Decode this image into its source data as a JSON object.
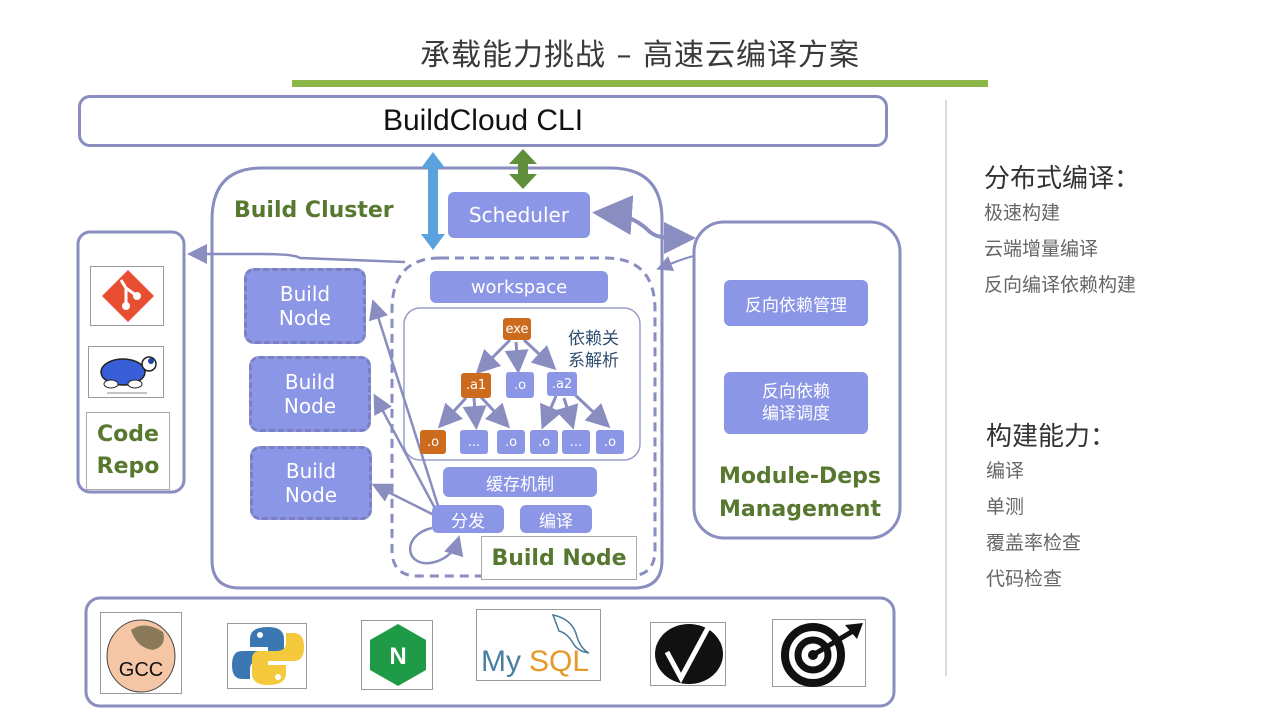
{
  "title": "承载能力挑战 – 高速云编译方案",
  "cli": {
    "label": "BuildCloud CLI"
  },
  "build_cluster": {
    "label": "Build Cluster",
    "scheduler": "Scheduler",
    "build_nodes": [
      "Build\nNode",
      "Build\nNode",
      "Build\nNode"
    ],
    "build_node_detail": {
      "label": "Build Node",
      "workspace": "workspace",
      "dependency_label": "依赖关系解析",
      "dependency_label_lines": [
        "依赖关",
        "系解析"
      ],
      "tree": {
        "root": "exe",
        "level1": [
          ".a1",
          ".o",
          ".a2"
        ],
        "level2": [
          ".o",
          "...",
          ".o",
          ".o",
          "...",
          ".o"
        ]
      },
      "cache": "缓存机制",
      "dispatch": "分发",
      "compile": "编译"
    }
  },
  "code_repo": {
    "label_lines": [
      "Code",
      "Repo"
    ],
    "logos": [
      "git-logo",
      "tortoisesvn-logo"
    ]
  },
  "module_deps": {
    "items": [
      "反向依赖管理",
      "反向依赖\n编译调度"
    ],
    "item2_lines": [
      "反向依赖",
      "编译调度"
    ],
    "label_lines": [
      "Module-Deps",
      "Management"
    ]
  },
  "toolchain": {
    "logos": [
      {
        "name": "gcc-logo",
        "text": "GCC"
      },
      {
        "name": "python-logo",
        "text": ""
      },
      {
        "name": "nginx-logo",
        "text": "N"
      },
      {
        "name": "mysql-logo",
        "text_my": "My",
        "text_sql": "SQL"
      },
      {
        "name": "check-logo",
        "text": ""
      },
      {
        "name": "target-logo",
        "text": ""
      }
    ]
  },
  "sidebar": {
    "sections": [
      {
        "heading": "分布式编译：",
        "items": [
          "极速构建",
          "云端增量编译",
          "反向编译依赖构建"
        ]
      },
      {
        "heading": "构建能力：",
        "items": [
          "编译",
          "单测",
          "覆盖率检查",
          "代码检查"
        ]
      }
    ]
  },
  "colors": {
    "accent_green": "#8db648",
    "label_green": "#56782f",
    "box_fill": "#8c96e6",
    "border": "#8a8dc0",
    "orange": "#cc6a1e",
    "arrow_blue": "#5aa2de",
    "arrow_green": "#5f8f3a"
  }
}
